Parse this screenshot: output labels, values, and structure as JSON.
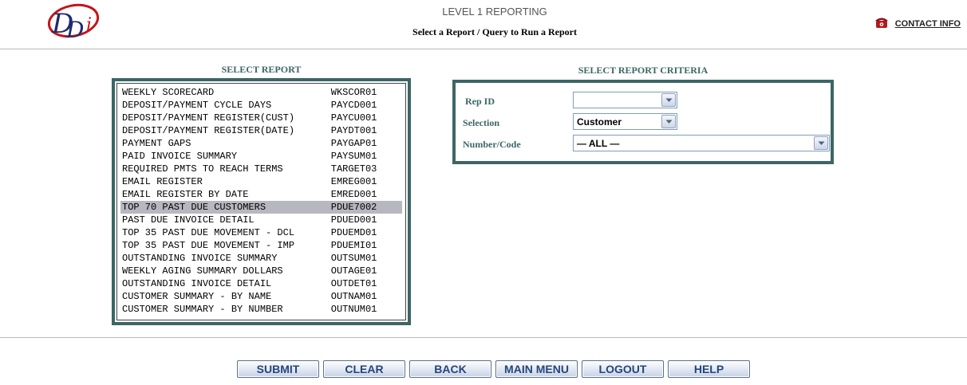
{
  "header": {
    "title": "LEVEL 1 REPORTING",
    "subtitle": "Select a Report / Query to Run a Report",
    "contact_label": "CONTACT INFO",
    "logo_text": "DDi",
    "icons": {
      "logo": "ddi-logo",
      "contact": "phone-icon"
    }
  },
  "colors": {
    "accent": "#3c6665",
    "selected_row": "#b7b7bf",
    "button_text": "#25467a",
    "logo_red": "#c4141b",
    "logo_navy": "#1f2b6b"
  },
  "report_panel": {
    "heading": "SELECT REPORT",
    "selected_index": 9,
    "reports": [
      {
        "name": "WEEKLY SCORECARD",
        "code": "WKSCOR01"
      },
      {
        "name": "DEPOSIT/PAYMENT CYCLE DAYS",
        "code": "PAYCD001"
      },
      {
        "name": "DEPOSIT/PAYMENT REGISTER(CUST)",
        "code": "PAYCU001"
      },
      {
        "name": "DEPOSIT/PAYMENT REGISTER(DATE)",
        "code": "PAYDT001"
      },
      {
        "name": "PAYMENT GAPS",
        "code": "PAYGAP01"
      },
      {
        "name": "PAID INVOICE SUMMARY",
        "code": "PAYSUM01"
      },
      {
        "name": "REQUIRED PMTS TO REACH TERMS",
        "code": "TARGET03"
      },
      {
        "name": "EMAIL REGISTER",
        "code": "EMREG001"
      },
      {
        "name": "EMAIL REGISTER BY DATE",
        "code": "EMRED001"
      },
      {
        "name": "TOP 70 PAST DUE CUSTOMERS",
        "code": "PDUE7002"
      },
      {
        "name": "PAST DUE INVOICE DETAIL",
        "code": "PDUED001"
      },
      {
        "name": "TOP 35 PAST DUE MOVEMENT - DCL",
        "code": "PDUEMD01"
      },
      {
        "name": "TOP 35 PAST DUE MOVEMENT - IMP",
        "code": "PDUEMI01"
      },
      {
        "name": "OUTSTANDING INVOICE SUMMARY",
        "code": "OUTSUM01"
      },
      {
        "name": "WEEKLY AGING SUMMARY DOLLARS",
        "code": "OUTAGE01"
      },
      {
        "name": "OUTSTANDING INVOICE DETAIL",
        "code": "OUTDET01"
      },
      {
        "name": "CUSTOMER SUMMARY - BY NAME",
        "code": "OUTNAM01"
      },
      {
        "name": "CUSTOMER SUMMARY - BY NUMBER",
        "code": "OUTNUM01"
      }
    ]
  },
  "criteria_panel": {
    "heading": "SELECT REPORT CRITERIA",
    "rep_id": {
      "label": "Rep ID",
      "value": ""
    },
    "selection": {
      "label": "Selection",
      "value": "Customer"
    },
    "number_code": {
      "label": "Number/Code",
      "value": "— ALL —"
    }
  },
  "buttons": {
    "submit": "SUBMIT",
    "clear": "CLEAR",
    "back": "BACK",
    "main_menu": "MAIN MENU",
    "logout": "LOGOUT",
    "help": "HELP"
  }
}
